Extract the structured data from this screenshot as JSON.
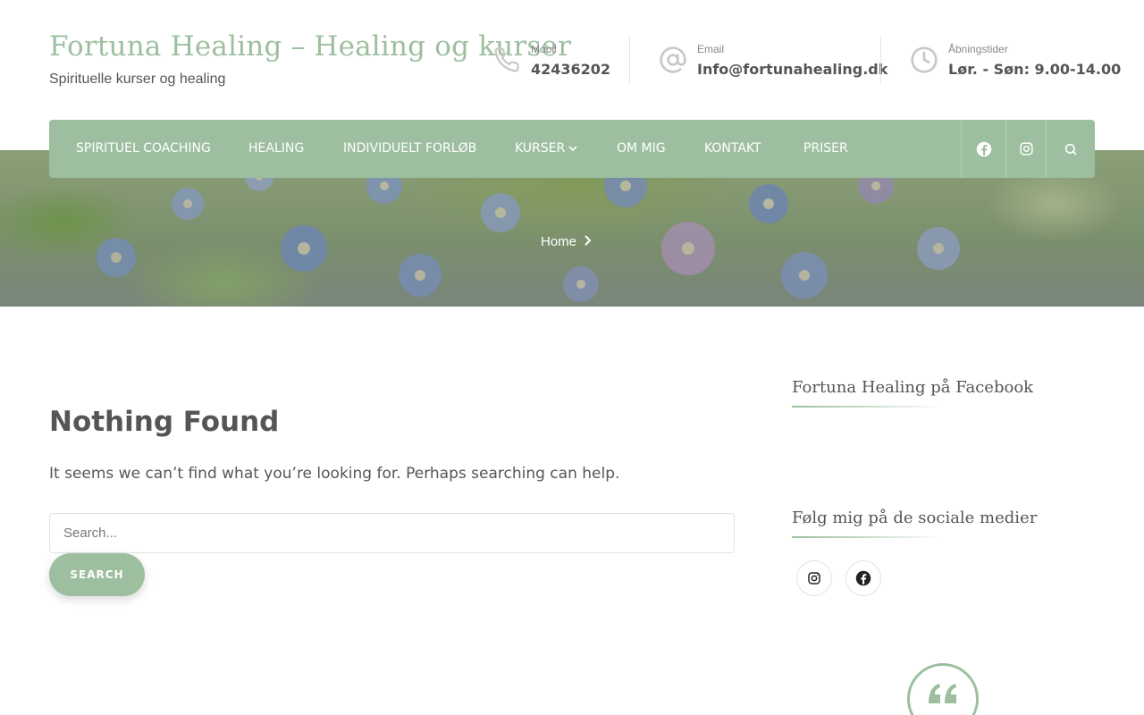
{
  "header": {
    "site_title": "Fortuna Healing – Healing og kurser",
    "tagline": "Spirituelle kurser og healing",
    "contacts": [
      {
        "icon": "phone-icon",
        "label": "Mobil",
        "value": "42436202"
      },
      {
        "icon": "at-sign-icon",
        "label": "Email",
        "value": "Info@fortunahealing.dk"
      },
      {
        "icon": "clock-icon",
        "label": "Åbningstider",
        "value": "Lør. - Søn: 9.00-14.00"
      }
    ]
  },
  "nav": {
    "items": [
      "Spirituel coaching",
      "Healing",
      "Individuelt forløb",
      "Kurser",
      "Om mig",
      "Kontakt",
      "Priser"
    ],
    "icons": [
      "facebook-icon",
      "instagram-icon",
      "search-icon"
    ]
  },
  "hero": {
    "breadcrumb": "Home"
  },
  "main": {
    "title": "Nothing Found",
    "message": "It seems we can’t find what you’re looking for. Perhaps searching can help.",
    "search_placeholder": "Search...",
    "search_value": "",
    "search_button": "Search"
  },
  "sidebar": {
    "facebook_title": "Fortuna Healing på Facebook",
    "social_title": "Følg mig på de sociale medier",
    "social_icons": [
      "instagram-icon",
      "facebook-icon"
    ],
    "quote_icon": "quote-icon"
  },
  "colors": {
    "accent": "#9dbf9f",
    "text": "#555555",
    "icon_gray": "#c8c8c8"
  }
}
